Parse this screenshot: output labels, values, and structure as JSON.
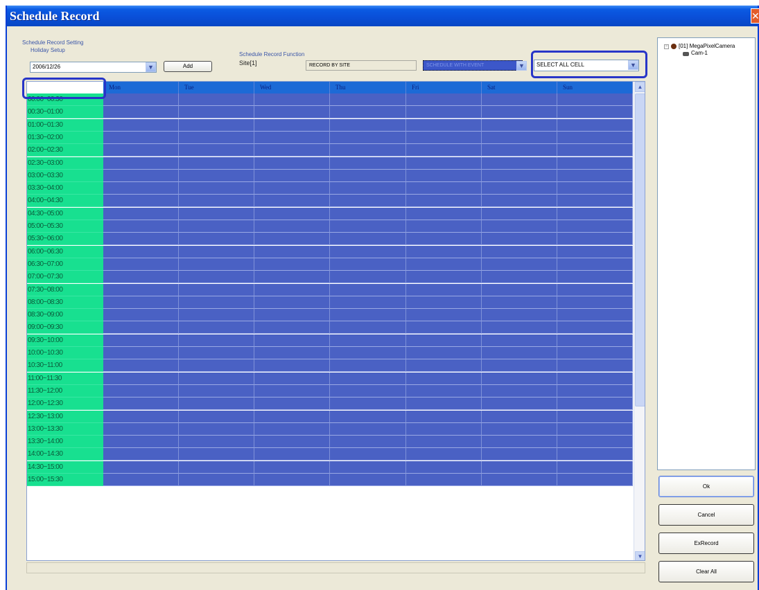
{
  "window": {
    "title": "Schedule Record",
    "close_symbol": "✕"
  },
  "settings": {
    "group_label": "Schedule Record Setting",
    "holiday_label": "Holiday Setup",
    "holiday_value": "2006/12/26",
    "add_label": "Add",
    "function_label": "Schedule Record Function",
    "site_label": "Site[1]",
    "record_by_site": "RECORD BY SITE",
    "schedule_mode": "SCHEDULE WITH EVENT",
    "cell_select": "SELECT ALL CELL"
  },
  "grid": {
    "corner_value": "",
    "days": [
      "Mon",
      "Tue",
      "Wed",
      "Thu",
      "Fri",
      "Sat",
      "Sun"
    ],
    "times": [
      "00:00~00:30",
      "00:30~01:00",
      "01:00~01:30",
      "01:30~02:00",
      "02:00~02:30",
      "02:30~03:00",
      "03:00~03:30",
      "03:30~04:00",
      "04:00~04:30",
      "04:30~05:00",
      "05:00~05:30",
      "05:30~06:00",
      "06:00~06:30",
      "06:30~07:00",
      "07:00~07:30",
      "07:30~08:00",
      "08:00~08:30",
      "08:30~09:00",
      "09:00~09:30",
      "09:30~10:00",
      "10:00~10:30",
      "10:30~11:00",
      "11:00~11:30",
      "11:30~12:00",
      "12:00~12:30",
      "12:30~13:00",
      "13:00~13:30",
      "13:30~14:00",
      "14:00~14:30",
      "14:30~15:00",
      "15:00~15:30"
    ]
  },
  "tree": {
    "expand_symbol": "−",
    "site": "[01] MegaPixelCamera",
    "camera": "Cam-1"
  },
  "buttons": {
    "ok": "Ok",
    "cancel": "Cancel",
    "exrecord": "ExRecord",
    "clear_all": "Clear All"
  },
  "colors": {
    "time_cell": "#18e090",
    "schedule_cell": "#4a61c4",
    "header": "#1c6ad6",
    "highlight_ring": "#2735c8"
  }
}
